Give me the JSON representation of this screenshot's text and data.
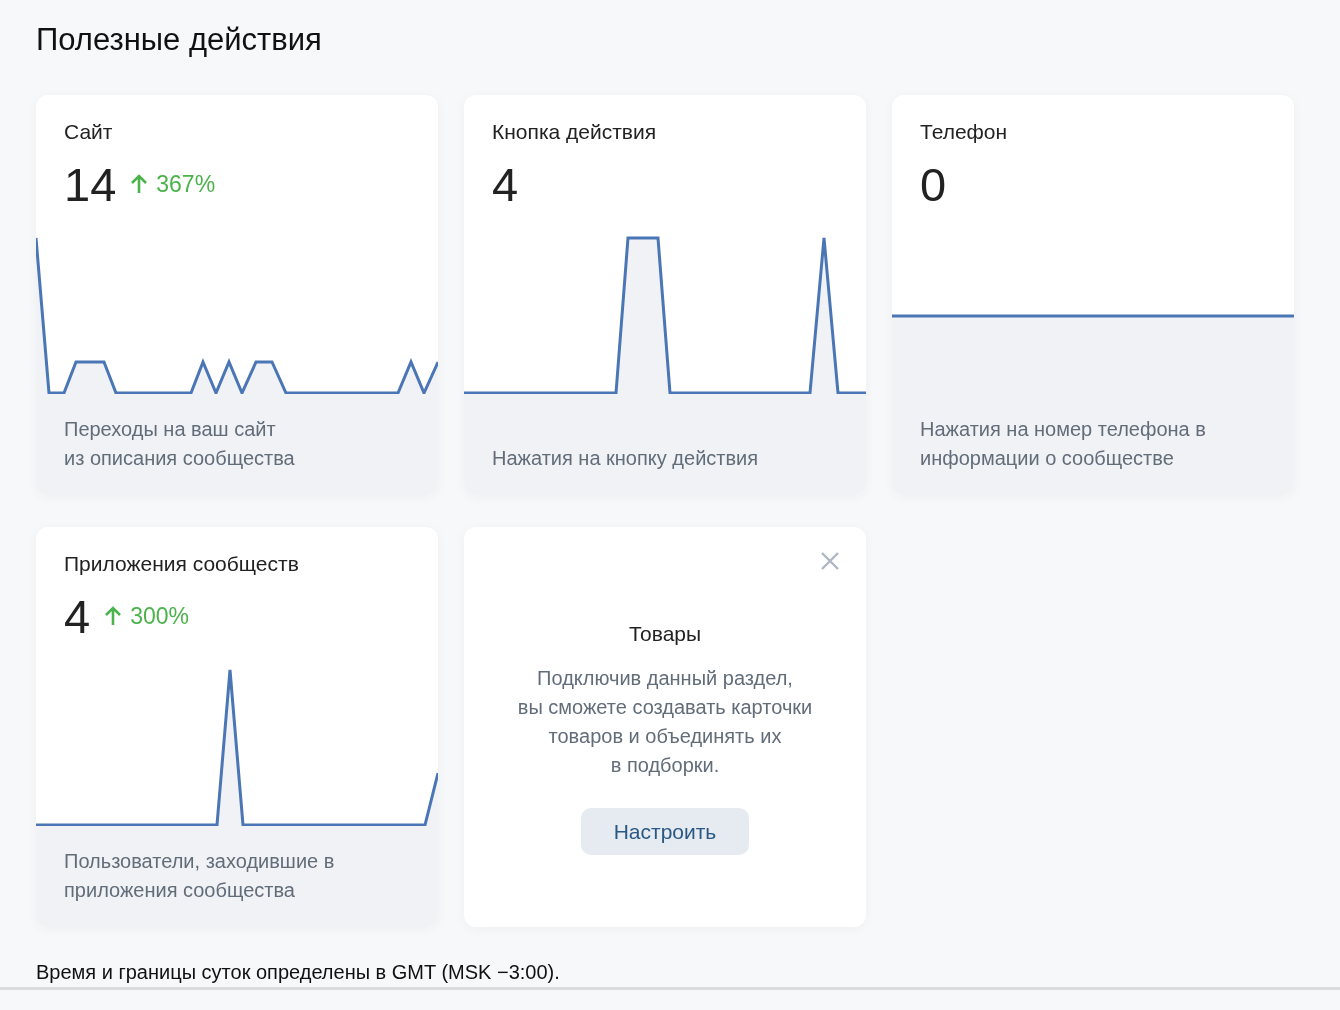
{
  "title": "Полезные действия",
  "cards": [
    {
      "title": "Сайт",
      "value": "14",
      "change": "367%",
      "description": "Переходы на ваш сайт\nиз описания сообщества"
    },
    {
      "title": "Кнопка действия",
      "value": "4",
      "description": "Нажатия на кнопку действия"
    },
    {
      "title": "Телефон",
      "value": "0",
      "description": "Нажатия на номер телефона в\nинформации о сообществе"
    },
    {
      "title": "Приложения сообществ",
      "value": "4",
      "change": "300%",
      "description": "Пользователи, заходившие в\nприложения сообщества"
    }
  ],
  "promo": {
    "title": "Товары",
    "text": "Подключив данный раздел,\nвы сможете создавать карточки\nтоваров и объединять их\nв подборки.",
    "button": "Настроить"
  },
  "footnote": "Время и границы суток определены в GMT (MSK −3:00)."
}
